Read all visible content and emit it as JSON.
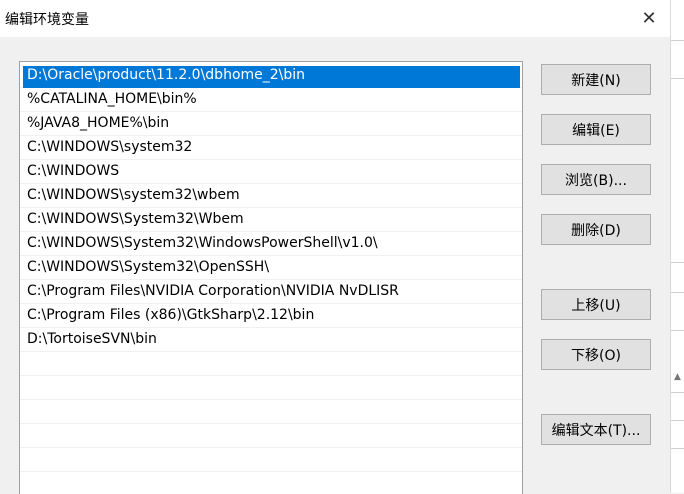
{
  "window": {
    "title": "编辑环境变量",
    "close_glyph": "✕"
  },
  "path_list": {
    "items": [
      {
        "label": "D:\\Oracle\\product\\11.2.0\\dbhome_2\\bin",
        "selected": true
      },
      {
        "label": "%CATALINA_HOME\\bin%",
        "selected": false
      },
      {
        "label": "%JAVA8_HOME%\\bin",
        "selected": false
      },
      {
        "label": "C:\\WINDOWS\\system32",
        "selected": false
      },
      {
        "label": "C:\\WINDOWS",
        "selected": false
      },
      {
        "label": "C:\\WINDOWS\\system32\\wbem",
        "selected": false
      },
      {
        "label": "C:\\WINDOWS\\System32\\Wbem",
        "selected": false
      },
      {
        "label": "C:\\WINDOWS\\System32\\WindowsPowerShell\\v1.0\\",
        "selected": false
      },
      {
        "label": "C:\\WINDOWS\\System32\\OpenSSH\\",
        "selected": false
      },
      {
        "label": "C:\\Program Files\\NVIDIA Corporation\\NVIDIA NvDLISR",
        "selected": false
      },
      {
        "label": "C:\\Program Files (x86)\\GtkSharp\\2.12\\bin",
        "selected": false
      },
      {
        "label": "D:\\TortoiseSVN\\bin",
        "selected": false
      }
    ]
  },
  "buttons": {
    "new": "新建(N)",
    "edit": "编辑(E)",
    "browse": "浏览(B)...",
    "delete": "删除(D)",
    "move_up": "上移(U)",
    "move_down": "下移(O)",
    "edit_text": "编辑文本(T)..."
  },
  "colors": {
    "selection": "#0078d7",
    "dialog_bg": "#f0f0f0",
    "button_bg": "#e1e1e1"
  }
}
